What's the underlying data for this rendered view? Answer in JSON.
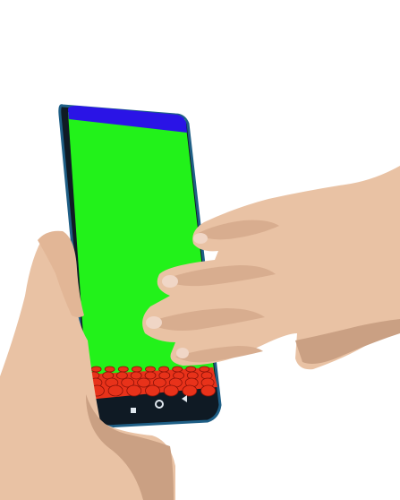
{
  "scene": {
    "background_color": "#ffffff",
    "phone": {
      "frame_color": "#0f1a24",
      "frame_edge_color": "#1f5f86",
      "status_bar_color": "#2a14e6",
      "screen_color": "#22f21a",
      "theater_seat_color": "#e8321a",
      "theater_seat_shadow_color": "#8a1208",
      "nav_bar_icons": [
        "square-icon",
        "circle-icon",
        "triangle-back-icon"
      ]
    },
    "hands": {
      "skin_color": "#e9c2a4",
      "skin_shadow_color": "#caa083",
      "nail_color": "#f0d6c6"
    }
  }
}
